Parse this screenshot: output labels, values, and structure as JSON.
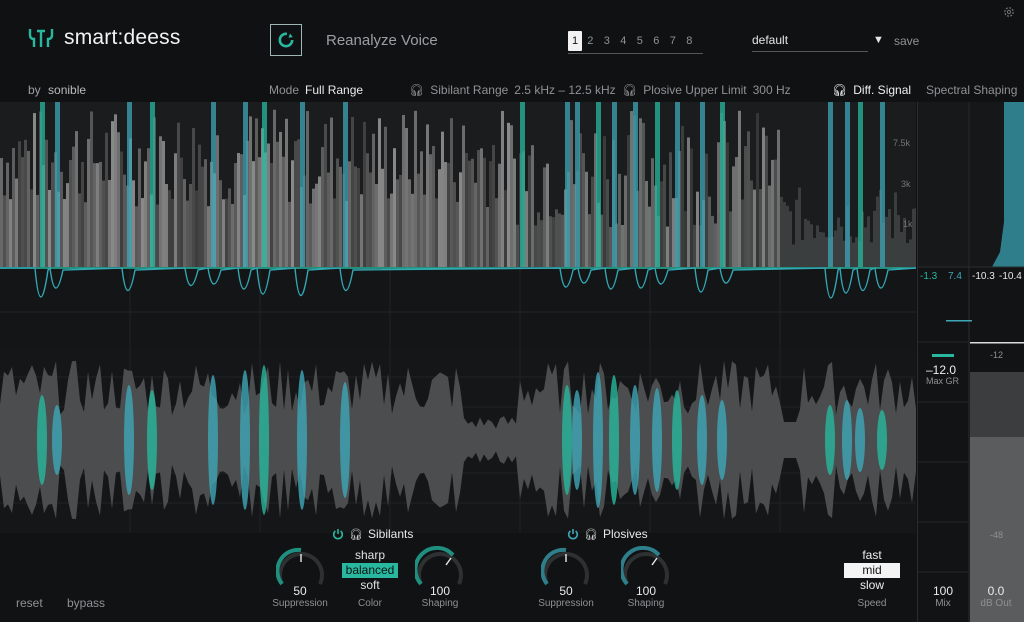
{
  "header": {
    "app_name": "smart:deess",
    "by_label": "by",
    "brand": "sonible",
    "reanalyze_label": "Reanalyze Voice",
    "slots": [
      "1",
      "2",
      "3",
      "4",
      "5",
      "6",
      "7",
      "8"
    ],
    "active_slot": "1",
    "preset_name": "default",
    "save_label": "save"
  },
  "modebar": {
    "mode_label": "Mode",
    "mode_value": "Full Range",
    "sibilant_label": "Sibilant Range",
    "sibilant_value": "2.5 kHz – 12.5 kHz",
    "plosive_label": "Plosive Upper Limit",
    "plosive_value": "300 Hz",
    "diff_label": "Diff. Signal",
    "spectral_label": "Spectral Shaping"
  },
  "spectrogram": {
    "freq_labels": [
      "7.5k",
      "3k",
      "1k"
    ]
  },
  "meters": {
    "gr_sib": "-1.3",
    "gr_plo": "7.4",
    "out_l": "-10.3",
    "out_r": "-10.4",
    "max_gr_value": "–12.0",
    "max_gr_label": "Max GR",
    "scale_12": "-12",
    "scale_48": "-48"
  },
  "sibilants": {
    "title": "Sibilants",
    "suppression_value": "50",
    "suppression_label": "Suppression",
    "color_options": [
      "sharp",
      "balanced",
      "soft"
    ],
    "color_selected": "balanced",
    "color_label": "Color",
    "shaping_value": "100",
    "shaping_label": "Shaping"
  },
  "plosives": {
    "title": "Plosives",
    "suppression_value": "50",
    "suppression_label": "Suppression",
    "shaping_value": "100",
    "shaping_label": "Shaping"
  },
  "speed": {
    "options": [
      "fast",
      "mid",
      "slow"
    ],
    "selected": "mid",
    "label": "Speed"
  },
  "mix": {
    "value": "100",
    "label": "Mix"
  },
  "out": {
    "value": "0.0",
    "label": "dB Out"
  },
  "footer": {
    "reset_label": "reset",
    "bypass_label": "bypass"
  },
  "colors": {
    "accent": "#28b89f",
    "accent_blue": "#3fa6b7",
    "background": "#111213"
  }
}
